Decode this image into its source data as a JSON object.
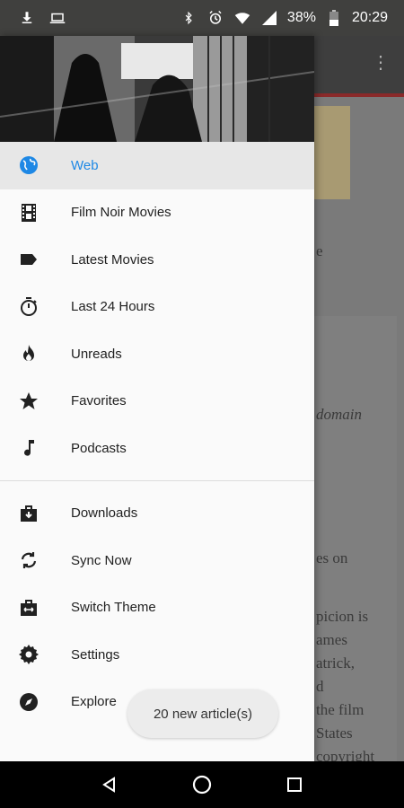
{
  "status_bar": {
    "battery": "38%",
    "time": "20:29",
    "icons": [
      "download-icon",
      "laptop-icon",
      "bluetooth-icon",
      "alarm-icon",
      "wifi-icon",
      "signal-icon",
      "battery-icon"
    ]
  },
  "drawer": {
    "header_image": "film-noir-still",
    "primary_items": [
      {
        "label": "Web",
        "icon": "globe-icon",
        "active": true
      },
      {
        "label": "Film Noir Movies",
        "icon": "film-icon",
        "active": false
      },
      {
        "label": "Latest Movies",
        "icon": "label-icon",
        "active": false
      },
      {
        "label": "Last 24 Hours",
        "icon": "timer-icon",
        "active": false
      },
      {
        "label": "Unreads",
        "icon": "flame-icon",
        "active": false
      },
      {
        "label": "Favorites",
        "icon": "star-icon",
        "active": false
      },
      {
        "label": "Podcasts",
        "icon": "music-note-icon",
        "active": false
      }
    ],
    "secondary_items": [
      {
        "label": "Downloads",
        "icon": "downloads-icon"
      },
      {
        "label": "Sync Now",
        "icon": "sync-icon"
      },
      {
        "label": "Switch Theme",
        "icon": "switch-theme-icon"
      },
      {
        "label": "Settings",
        "icon": "gear-icon"
      },
      {
        "label": "Explore",
        "icon": "compass-icon"
      }
    ]
  },
  "snackbar": {
    "text": "20 new article(s)"
  },
  "background": {
    "fragments": [
      "e",
      "domain",
      "es on",
      "picion is",
      "ames",
      "atrick,",
      "d",
      "the film",
      "States",
      "copyright"
    ]
  },
  "colors": {
    "accent": "#1e88e5",
    "status_bar": "#40403e",
    "drawer_bg": "#fafafa"
  }
}
